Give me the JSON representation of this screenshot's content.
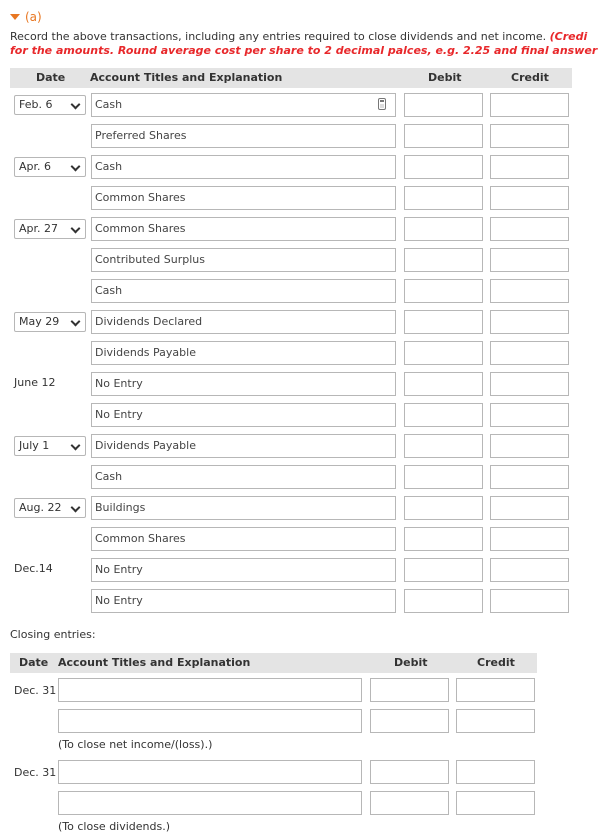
{
  "section": {
    "label": "(a)"
  },
  "instructions": {
    "line1_plain": "Record the above transactions, including any entries required to close dividends and net income. ",
    "line1_red": "(Credi",
    "line2_red": "for the amounts. Round average cost per share to 2 decimal palces, e.g. 2.25 and final answer"
  },
  "journal": {
    "headers": {
      "date": "Date",
      "account": "Account Titles and Explanation",
      "debit": "Debit",
      "credit": "Credit"
    },
    "rows": [
      {
        "date": "Feb. 6",
        "date_type": "select",
        "account": "Cash"
      },
      {
        "date": "",
        "date_type": "none",
        "account": "Preferred Shares"
      },
      {
        "date": "Apr. 6",
        "date_type": "select",
        "account": "Cash"
      },
      {
        "date": "",
        "date_type": "none",
        "account": "Common Shares"
      },
      {
        "date": "Apr. 27",
        "date_type": "select",
        "account": "Common Shares"
      },
      {
        "date": "",
        "date_type": "none",
        "account": "Contributed Surplus"
      },
      {
        "date": "",
        "date_type": "none",
        "account": "Cash"
      },
      {
        "date": "May 29",
        "date_type": "select",
        "account": "Dividends Declared"
      },
      {
        "date": "",
        "date_type": "none",
        "account": "Dividends Payable"
      },
      {
        "date": "June 12",
        "date_type": "text",
        "account": "No Entry"
      },
      {
        "date": "",
        "date_type": "none",
        "account": "No Entry"
      },
      {
        "date": "July 1",
        "date_type": "select",
        "account": "Dividends Payable"
      },
      {
        "date": "",
        "date_type": "none",
        "account": "Cash"
      },
      {
        "date": "Aug. 22",
        "date_type": "select",
        "account": "Buildings"
      },
      {
        "date": "",
        "date_type": "none",
        "account": "Common Shares"
      },
      {
        "date": "Dec.14",
        "date_type": "text",
        "account": "No Entry"
      },
      {
        "date": "",
        "date_type": "none",
        "account": "No Entry"
      }
    ]
  },
  "closing": {
    "label": "Closing entries:",
    "headers": {
      "date": "Date",
      "account": "Account Titles and Explanation",
      "debit": "Debit",
      "credit": "Credit"
    },
    "entries": [
      {
        "date": "Dec. 31",
        "note": "(To close net income/(loss).)"
      },
      {
        "date": "Dec. 31",
        "note": "(To close dividends.)"
      }
    ]
  },
  "icons": {
    "calculator": "calculator-icon",
    "collapse": "triangle-down-icon",
    "dropdown": "chevron-down-icon"
  },
  "colors": {
    "accent": "#e87722",
    "instruction_red": "#e8282b",
    "header_bg": "#e4e4e4",
    "border": "#b7b7b7"
  }
}
